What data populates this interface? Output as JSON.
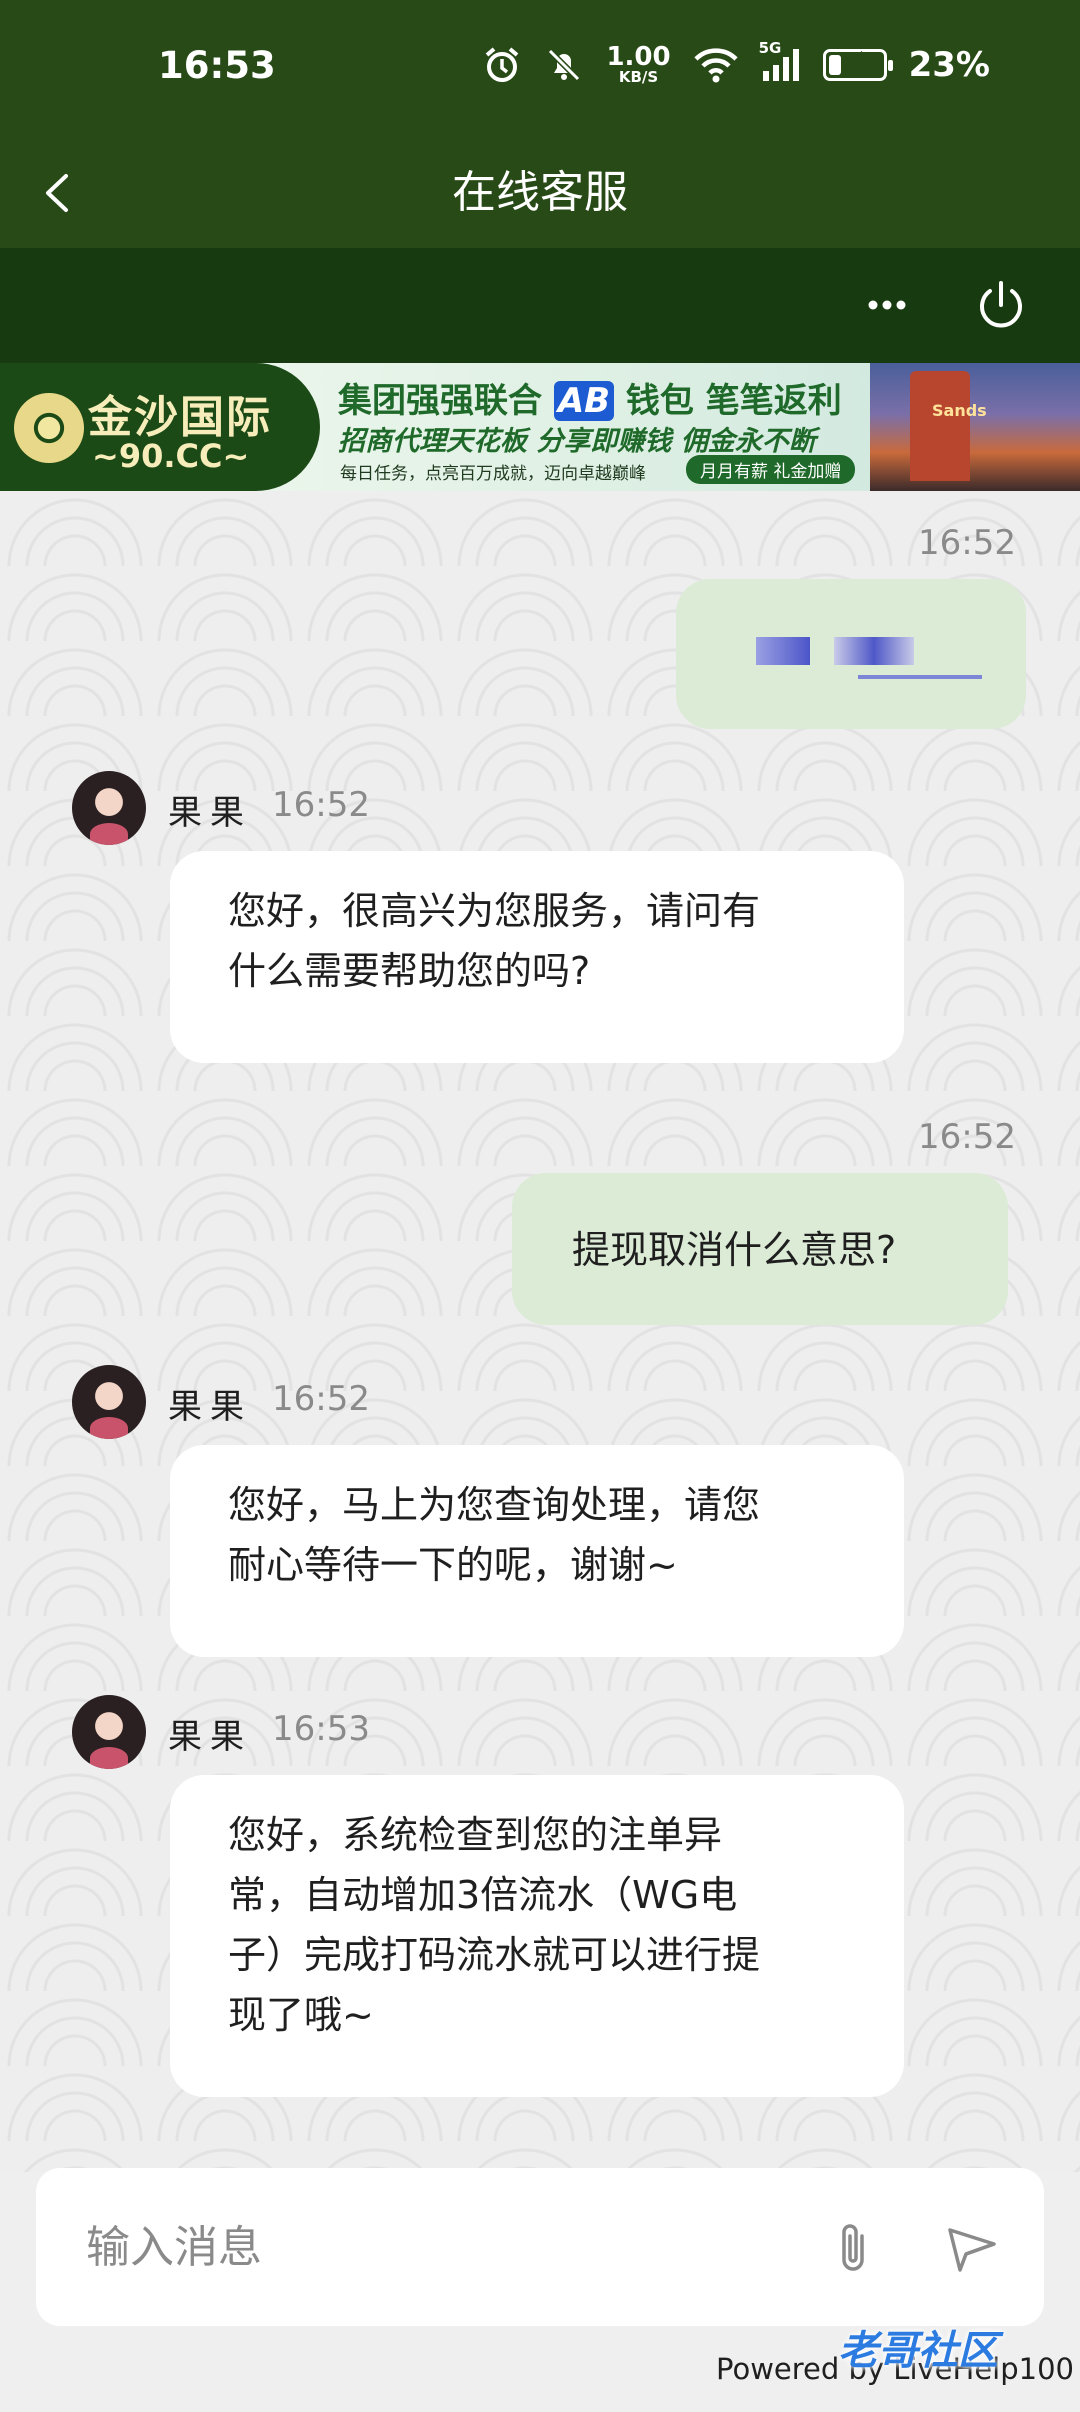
{
  "status_bar": {
    "time": "16:53",
    "net_speed_value": "1.00",
    "net_speed_unit": "KB/S",
    "signal_label": "5G",
    "battery_percent": "23%",
    "battery_level": 0.23,
    "icons": [
      "alarm-icon",
      "bell-off-icon",
      "wifi-icon",
      "signal-icon",
      "battery-charging-icon"
    ]
  },
  "header": {
    "title": "在线客服",
    "back_icon": "chevron-left-icon",
    "more_icon": "more-horizontal-icon",
    "power_icon": "power-icon"
  },
  "banner": {
    "brand_name": "金沙国际",
    "brand_domain": "~90.CC~",
    "headline_prefix": "集团强强联合",
    "headline_ab": "AB",
    "headline_suffix": "钱包  笔笔返利",
    "subline": "招商代理天花板 分享即赚钱 佣金永不断",
    "small_text": "每日任务，点亮百万成就，迈向卓越巅峰",
    "pill_text": "月月有薪 礼金加赠",
    "photo_sign": "Sands"
  },
  "messages": [
    {
      "direction": "out",
      "time": "16:52",
      "redacted": true
    },
    {
      "direction": "in",
      "sender": "果果",
      "time": "16:52",
      "lines": [
        "您好，很高兴为您服务，请问有",
        "什么需要帮助您的吗?"
      ]
    },
    {
      "direction": "out",
      "time": "16:52",
      "text": "提现取消什么意思?"
    },
    {
      "direction": "in",
      "sender": "果果",
      "time": "16:52",
      "lines": [
        "您好，马上为您查询处理，请您",
        "耐心等待一下的呢，谢谢~"
      ]
    },
    {
      "direction": "in",
      "sender": "果果",
      "time": "16:53",
      "lines": [
        "您好，系统检查到您的注单异",
        "常，自动增加3倍流水（WG电",
        "子）完成打码流水就可以进行提",
        "现了哦~"
      ]
    }
  ],
  "composer": {
    "placeholder": "输入消息",
    "attach_icon": "paperclip-icon",
    "send_icon": "send-icon"
  },
  "footer": {
    "powered_by": "Powered by LiveHelp100",
    "watermark": "老哥社区"
  },
  "colors": {
    "header_bg": "#284a17",
    "toolbar_bg": "#183a10",
    "outgoing_bubble": "#dcebd6",
    "incoming_bubble": "#ffffff"
  }
}
